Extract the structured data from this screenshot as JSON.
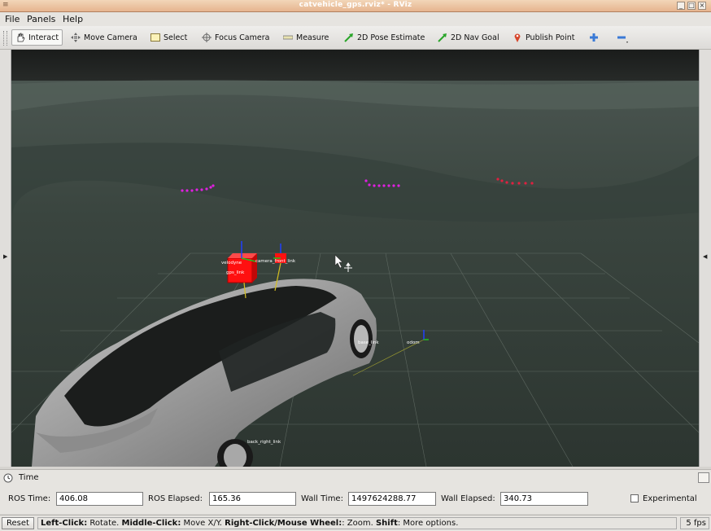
{
  "window": {
    "title": "catvehicle_gps.rviz* - RViz",
    "minimize": "_",
    "maximize": "□",
    "close": "×"
  },
  "menubar": {
    "items": [
      "File",
      "Panels",
      "Help"
    ]
  },
  "toolbar": {
    "tools": [
      {
        "label": "Interact",
        "icon": "hand-icon"
      },
      {
        "label": "Move Camera",
        "icon": "move-camera-icon"
      },
      {
        "label": "Select",
        "icon": "select-icon"
      },
      {
        "label": "Focus Camera",
        "icon": "focus-camera-icon"
      },
      {
        "label": "Measure",
        "icon": "measure-icon"
      },
      {
        "label": "2D Pose Estimate",
        "icon": "arrow-icon"
      },
      {
        "label": "2D Nav Goal",
        "icon": "arrow-icon"
      },
      {
        "label": "Publish Point",
        "icon": "pin-icon"
      }
    ],
    "add_icon": "plus-icon",
    "remove_icon": "minus-icon",
    "colors": {
      "pose": "#2aa52a",
      "pin": "#d6452a",
      "plus": "#3a7ad6"
    }
  },
  "viewport": {
    "frame_labels": [
      "velodyne",
      "camera_front_link",
      "gps_link",
      "base_link",
      "odom",
      "back_right_link"
    ],
    "colors": {
      "sky": "#1e201f",
      "ground": "#3a423d",
      "grid": "#6f7a72",
      "points_magenta": "#e020e0",
      "points_red": "#e02040",
      "box": "#ff1010"
    }
  },
  "time_panel": {
    "header": "Time",
    "ros_time_label": "ROS Time:",
    "ros_time_value": "406.08",
    "ros_elapsed_label": "ROS Elapsed:",
    "ros_elapsed_value": "165.36",
    "wall_time_label": "Wall Time:",
    "wall_time_value": "1497624288.77",
    "wall_elapsed_label": "Wall Elapsed:",
    "wall_elapsed_value": "340.73",
    "experimental_label": "Experimental",
    "experimental_checked": false
  },
  "statusbar": {
    "reset_label": "Reset",
    "hint_left_click": "Left-Click:",
    "hint_rotate": " Rotate. ",
    "hint_middle_click": "Middle-Click:",
    "hint_move": " Move X/Y. ",
    "hint_right_click": "Right-Click/Mouse Wheel:",
    "hint_zoom": ": Zoom. ",
    "hint_shift": "Shift",
    "hint_more": ": More options.",
    "fps": "5 fps"
  }
}
